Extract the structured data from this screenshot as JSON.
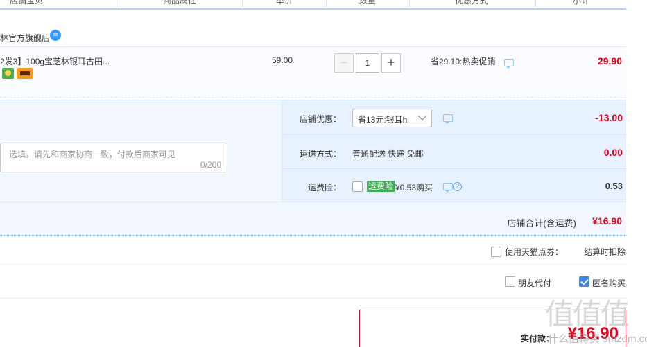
{
  "header": {
    "columns": [
      "店铺宝贝",
      "商品属性",
      "单价",
      "数量",
      "优惠方式",
      "小计"
    ]
  },
  "shop": {
    "name": "林官方旗舰店",
    "wangwang_icon": "wangwang-chat-icon"
  },
  "item": {
    "title": "2发3】100g宝芝林银耳古田...",
    "unit_price": "59.00",
    "quantity": "1",
    "minus": "−",
    "plus": "+",
    "promotion": "省29.10:热卖促销",
    "subtotal": "29.90"
  },
  "order": {
    "message_placeholder": "选填，请先和商家协商一致，付款后商家可见",
    "message_count": "0/200",
    "shop_discount_label": "店铺优惠：",
    "shop_discount_select": "省13元:银耳h",
    "shop_discount_value": "-13.00",
    "shipping_label": "运送方式：",
    "shipping_text": "普通配送 快递 免邮",
    "shipping_value": "0.00",
    "insurance_label": "运费险：",
    "insurance_badge": "运费险",
    "insurance_text": "¥0.53购买",
    "insurance_value": "0.53",
    "total_label": "店铺合计(含运费)",
    "total_value": "¥16.90"
  },
  "options": {
    "tmall_points": "使用天猫点券：",
    "tmall_points_note": "结算时扣除",
    "friend_pay": "朋友代付",
    "anonymous": "匿名购买"
  },
  "payment": {
    "label": "实付款：",
    "value": "¥16.90"
  },
  "watermark": {
    "main": "值值值",
    "sub": "什么值得买 smzdm.com"
  },
  "colors": {
    "price_red": "#e4001c",
    "accent_blue": "#3d88e6",
    "panel_blue": "#f2f7ff"
  }
}
